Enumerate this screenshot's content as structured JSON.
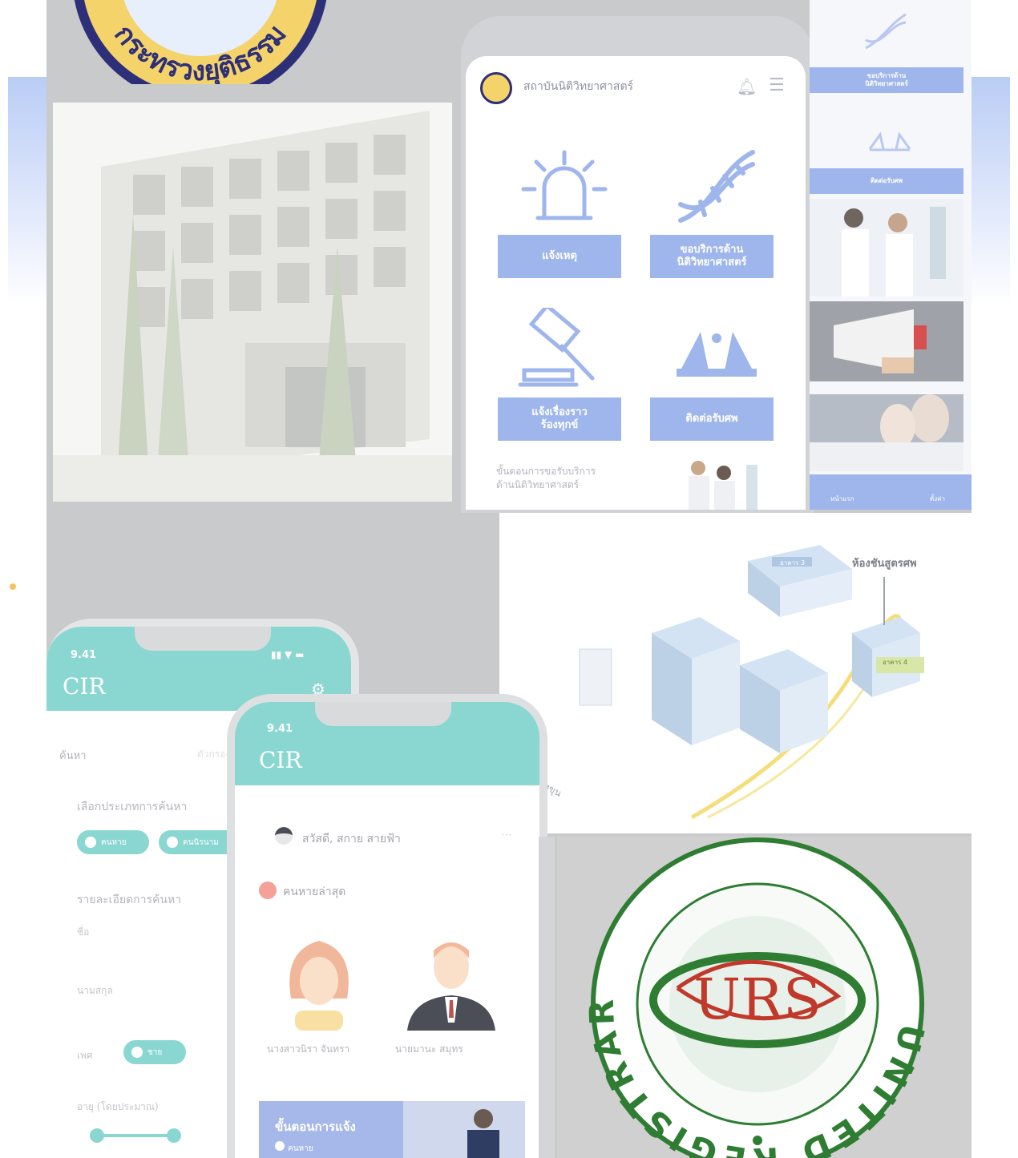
{
  "colors": {
    "service_blue": "#9fb6ec",
    "teal": "#8ad7d2",
    "seal_gold": "#f3d36a",
    "seal_navy": "#2d2f78",
    "urs_green": "#2e7d32",
    "urs_red": "#c0392b"
  },
  "seal": {
    "text": "กระทรวงยุติธรรม"
  },
  "forensic_app": {
    "header_title": "สถาบันนิติวิทยาศาสตร์",
    "icons": {
      "bell": "bell-icon",
      "menu": "hamburger-menu-icon"
    },
    "services": [
      {
        "label": "แจ้งเหตุ",
        "icon": "siren-icon"
      },
      {
        "label": "ขอบริการด้าน\nนิติวิทยาศาสตร์",
        "icon": "dna-icon"
      },
      {
        "label": "แจ้งเรื่องราว\nร้องทุกข์",
        "icon": "gavel-icon"
      },
      {
        "label": "ติดต่อรับศพ",
        "icon": "hands-icon"
      }
    ],
    "footer_text": "ขั้นตอนการขอรับบริการ\nด้านนิติวิทยาศาสตร์"
  },
  "right_strip": {
    "bars": [
      "ขอบริการด้าน\nนิติวิทยาศาสตร์",
      "ติดต่อรับศพ"
    ],
    "nav": [
      "หน้าแรก",
      "ตั้งค่า"
    ]
  },
  "iso_diagram": {
    "label": "ห้องชันสูตรศพ",
    "route_text": "บ้านม่วง - บางขุน",
    "building_tags": [
      "อาคาร 3",
      "อาคาร 4"
    ]
  },
  "cir_search": {
    "time": "9.41",
    "logo": "CIR",
    "search_label": "ค้นหา",
    "filter_label": "ตัวกรอง",
    "type_title": "เลือกประเภทการค้นหา",
    "type_options": [
      "คนหาย",
      "คนนิรนาม"
    ],
    "detail_title": "รายละเอียดการค้นหา",
    "fields": [
      "ชื่อ",
      "นามสกุล"
    ],
    "gender_label": "เพศ",
    "gender_value": "ชาย",
    "age_label": "อายุ (โดยประมาณ)"
  },
  "cir_home": {
    "time": "9.41",
    "logo": "CIR",
    "greeting": "สวัสดี, สกาย สายฟ้า",
    "section": "คนหายล่าสุด",
    "people": [
      "นางสาวนิรา จันทรา",
      "นายมานะ สมุทร"
    ],
    "banner_title": "ขั้นตอนการแจ้ง",
    "banner_sub": "คนหาย"
  },
  "urs_logo": {
    "ring_text": "UNITED REGISTRAR OF SYSTEMS",
    "initials": "URS"
  }
}
